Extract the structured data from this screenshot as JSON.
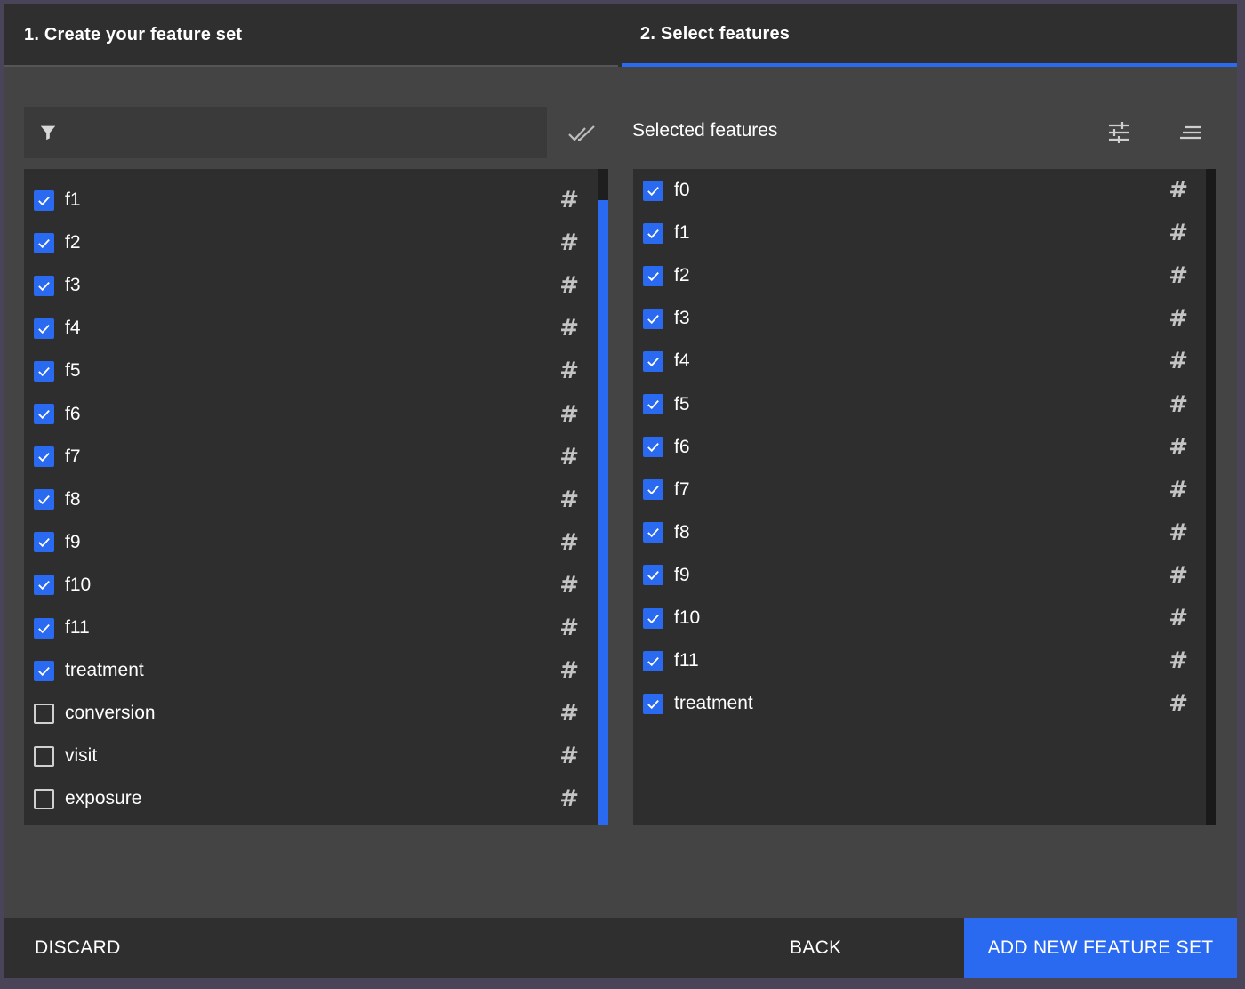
{
  "stepper": {
    "step1_label": "1. Create your feature set",
    "step2_label": "2. Select features"
  },
  "filter": {
    "placeholder": "",
    "icon": "filter-icon"
  },
  "available_features": [
    {
      "label": "f1",
      "checked": true,
      "type_icon": "#"
    },
    {
      "label": "f2",
      "checked": true,
      "type_icon": "#"
    },
    {
      "label": "f3",
      "checked": true,
      "type_icon": "#"
    },
    {
      "label": "f4",
      "checked": true,
      "type_icon": "#"
    },
    {
      "label": "f5",
      "checked": true,
      "type_icon": "#"
    },
    {
      "label": "f6",
      "checked": true,
      "type_icon": "#"
    },
    {
      "label": "f7",
      "checked": true,
      "type_icon": "#"
    },
    {
      "label": "f8",
      "checked": true,
      "type_icon": "#"
    },
    {
      "label": "f9",
      "checked": true,
      "type_icon": "#"
    },
    {
      "label": "f10",
      "checked": true,
      "type_icon": "#"
    },
    {
      "label": "f11",
      "checked": true,
      "type_icon": "#"
    },
    {
      "label": "treatment",
      "checked": true,
      "type_icon": "#"
    },
    {
      "label": "conversion",
      "checked": false,
      "type_icon": "#"
    },
    {
      "label": "visit",
      "checked": false,
      "type_icon": "#"
    },
    {
      "label": "exposure",
      "checked": false,
      "type_icon": "#"
    }
  ],
  "selected_panel": {
    "title": "Selected features"
  },
  "selected_features": [
    {
      "label": "f0",
      "checked": true,
      "type_icon": "#"
    },
    {
      "label": "f1",
      "checked": true,
      "type_icon": "#"
    },
    {
      "label": "f2",
      "checked": true,
      "type_icon": "#"
    },
    {
      "label": "f3",
      "checked": true,
      "type_icon": "#"
    },
    {
      "label": "f4",
      "checked": true,
      "type_icon": "#"
    },
    {
      "label": "f5",
      "checked": true,
      "type_icon": "#"
    },
    {
      "label": "f6",
      "checked": true,
      "type_icon": "#"
    },
    {
      "label": "f7",
      "checked": true,
      "type_icon": "#"
    },
    {
      "label": "f8",
      "checked": true,
      "type_icon": "#"
    },
    {
      "label": "f9",
      "checked": true,
      "type_icon": "#"
    },
    {
      "label": "f10",
      "checked": true,
      "type_icon": "#"
    },
    {
      "label": "f11",
      "checked": true,
      "type_icon": "#"
    },
    {
      "label": "treatment",
      "checked": true,
      "type_icon": "#"
    }
  ],
  "footer": {
    "discard_label": "DISCARD",
    "back_label": "BACK",
    "primary_label": "ADD NEW FEATURE SET"
  },
  "colors": {
    "accent": "#2a6af0",
    "background": "#444444",
    "panel": "#2e2e2e"
  }
}
